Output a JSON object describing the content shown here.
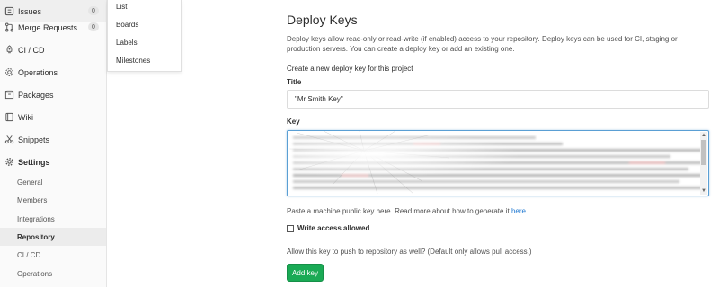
{
  "sidebar": {
    "items": [
      {
        "label": "Issues",
        "icon": "issues-icon",
        "badge": "0"
      },
      {
        "label": "Merge Requests",
        "icon": "merge-request-icon",
        "badge": "0"
      },
      {
        "label": "CI / CD",
        "icon": "rocket-icon"
      },
      {
        "label": "Operations",
        "icon": "cloud-gear-icon"
      },
      {
        "label": "Packages",
        "icon": "package-icon"
      },
      {
        "label": "Wiki",
        "icon": "book-icon"
      },
      {
        "label": "Snippets",
        "icon": "scissors-icon"
      },
      {
        "label": "Settings",
        "icon": "gear-icon"
      }
    ],
    "settings_subitems": [
      "General",
      "Members",
      "Integrations",
      "Repository",
      "CI / CD",
      "Operations"
    ],
    "active_subitem": "Repository"
  },
  "issues_flyout": {
    "items": [
      "List",
      "Boards",
      "Labels",
      "Milestones"
    ]
  },
  "main": {
    "title": "Deploy Keys",
    "description": "Deploy keys allow read-only or read-write (if enabled) access to your repository. Deploy keys can be used for CI, staging or production servers. You can create a deploy key or add an existing one.",
    "create_heading": "Create a new deploy key for this project",
    "title_label": "Title",
    "title_value": "\"Mr Smith Key\"",
    "key_label": "Key",
    "hint_text": "Paste a machine public key here. Read more about how to generate it",
    "hint_link": "here",
    "write_access_label": "Write access allowed",
    "write_access_checked": false,
    "allow_text": "Allow this key to push to repository as well? (Default only allows pull access.)",
    "add_button": "Add key"
  },
  "colors": {
    "accent_green": "#1aaa55",
    "link_blue": "#1f78d1",
    "focus_blue": "#5a9fd4"
  }
}
